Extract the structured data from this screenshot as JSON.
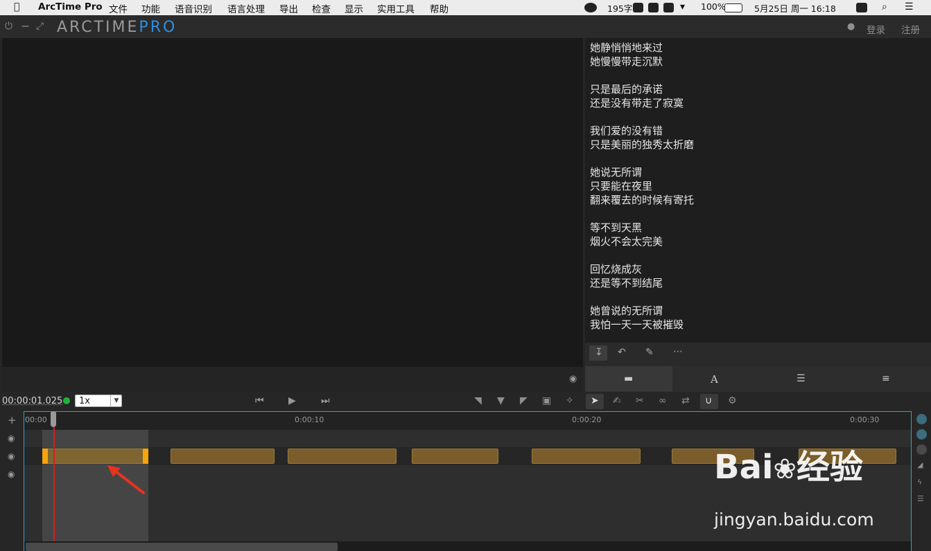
{
  "menubar": {
    "app_name": "ArcTime Pro",
    "items": [
      "文件",
      "功能",
      "语音识别",
      "语言处理",
      "导出",
      "检查",
      "显示",
      "实用工具",
      "帮助"
    ],
    "tray": {
      "word_count": "195字",
      "battery": "100%",
      "datetime": "5月25日 周一  16:18"
    }
  },
  "titlebar": {
    "logo_main": "ARCTIME",
    "logo_pro": "PRO",
    "login": "登录",
    "register": "注册"
  },
  "subtitles": {
    "lines": [
      "她静悄悄地来过",
      "她慢慢带走沉默",
      "",
      "只是最后的承诺",
      "还是没有带走了寂寞",
      "",
      "我们爱的没有错",
      "只是美丽的独秀太折磨",
      "",
      "她说无所谓",
      "只要能在夜里",
      "翻来覆去的时候有寄托",
      "",
      "等不到天黑",
      "烟火不会太完美",
      "",
      "回忆烧成灰",
      "还是等不到结尾",
      "",
      "她曾说的无所谓",
      "我怕一天一天被摧毁"
    ]
  },
  "transport": {
    "timecode": "00:00:01.025",
    "speed": "1x"
  },
  "timeline": {
    "ruler_labels": [
      "00:00",
      "0:00:10",
      "0:00:20",
      "0:00:30"
    ],
    "playhead_time": "00:00:01.025"
  },
  "watermark": {
    "brand": "Bai",
    "brand_cn": "经验",
    "url": "jingyan.baidu.com"
  },
  "colors": {
    "accent": "#2d8fe0",
    "clip": "#7a5d2a",
    "handle": "#f5a40e",
    "playhead": "#d42020",
    "timeline_border": "#2aa7c9"
  }
}
